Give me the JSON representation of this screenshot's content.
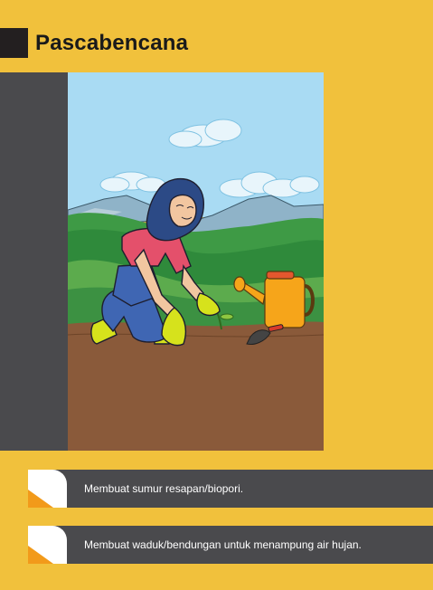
{
  "page": {
    "title": "Pascabencana"
  },
  "illustration": {
    "subject": "woman-gardening-icon"
  },
  "steps": [
    {
      "text": "Membuat sumur resapan/biopori."
    },
    {
      "text": "Membuat waduk/bendungan untuk menampung air hujan."
    }
  ],
  "colors": {
    "background": "#f1c13c",
    "panel": "#4a4a4d",
    "accent": "#f29a1a",
    "dark": "#231f20"
  }
}
